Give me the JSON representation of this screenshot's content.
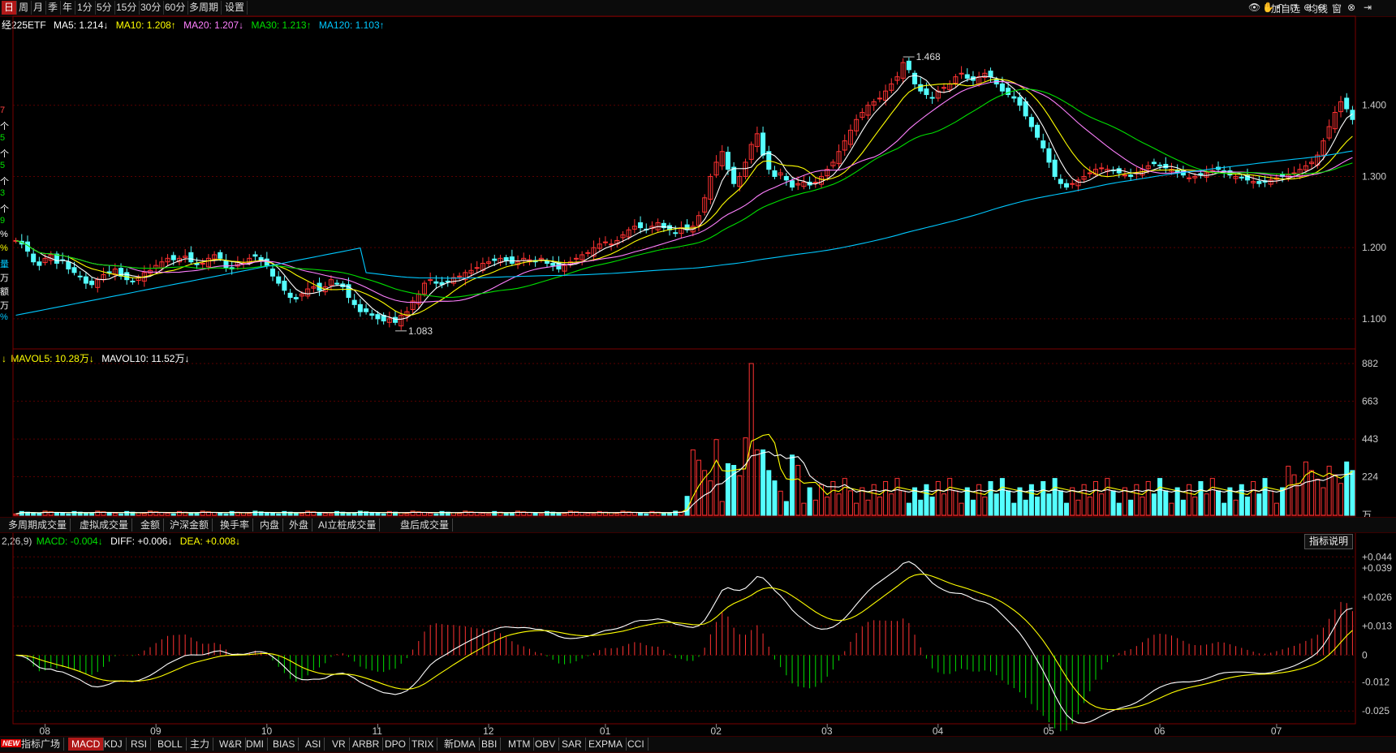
{
  "toolbar": {
    "periods": [
      "日",
      "周",
      "月",
      "季",
      "年",
      "1分",
      "5分",
      "15分",
      "30分",
      "60分",
      "多周期",
      "设置"
    ],
    "active_period": "日",
    "right_labels": [
      "加自选",
      "均线",
      "窗"
    ]
  },
  "price_info": {
    "title": "经225ETF",
    "ma5": "MA5: 1.214↓",
    "ma10": "MA10: 1.208↑",
    "ma20": "MA20: 1.207↓",
    "ma30": "MA30: 1.213↑",
    "ma120": "MA120: 1.103↑"
  },
  "volume_info": {
    "prefix": "↓",
    "mavol5": "MAVOL5: 10.28万↓",
    "mavol10": "MAVOL10: 11.52万↓"
  },
  "macd_info": {
    "params": "2,26,9)",
    "macd": "MACD: -0.004↓",
    "diff": "DIFF: +0.006↓",
    "dea": "DEA: +0.008↓"
  },
  "volume_tabs": [
    "多周期成交量",
    "虚拟成交量",
    "金额",
    "沪深金额",
    "换手率",
    "内盘",
    "外盘",
    "AI立桩成交量",
    "盘后成交量"
  ],
  "indicator_tabs": [
    "指标广场",
    "MACD",
    "KDJ",
    "RSI",
    "BOLL",
    "主力",
    "W&R",
    "DMI",
    "BIAS",
    "ASI",
    "VR",
    "ARBR",
    "DPO",
    "TRIX",
    "新DMA",
    "BBI",
    "MTM",
    "OBV",
    "SAR",
    "EXPMA",
    "CCI"
  ],
  "active_indicator": "MACD",
  "new_badge": "NEW",
  "explain_button": "指标说明",
  "left_strip": [
    "7",
    "个",
    "5",
    "个",
    "5",
    "个",
    "3",
    "个",
    "9",
    "%",
    "%",
    "量",
    "万",
    "额",
    "万",
    "%"
  ],
  "colors": {
    "up": "#ff3232",
    "down": "#54ffff",
    "ma5": "#ffffff",
    "ma10": "#ffff00",
    "ma20": "#ff80ff",
    "ma30": "#00e000",
    "ma120": "#00c8ff",
    "grid": "#5a0000"
  },
  "chart_data": [
    {
      "type": "candlestick",
      "x_months": [
        "08",
        "09",
        "10",
        "11",
        "12",
        "01",
        "02",
        "03",
        "04",
        "05",
        "06",
        "07"
      ],
      "y_ticks": [
        1.1,
        1.2,
        1.3,
        1.4
      ],
      "ylim": [
        1.06,
        1.5
      ],
      "annotations": [
        {
          "label": "1.468",
          "value": 1.468,
          "note": "high"
        },
        {
          "label": "1.083",
          "value": 1.083,
          "note": "low"
        }
      ],
      "close": [
        1.21,
        1.205,
        1.195,
        1.18,
        1.175,
        1.185,
        1.19,
        1.178,
        1.182,
        1.17,
        1.165,
        1.16,
        1.15,
        1.148,
        1.155,
        1.162,
        1.165,
        1.17,
        1.16,
        1.155,
        1.152,
        1.158,
        1.165,
        1.168,
        1.175,
        1.18,
        1.185,
        1.183,
        1.185,
        1.188,
        1.18,
        1.176,
        1.178,
        1.185,
        1.19,
        1.185,
        1.172,
        1.17,
        1.18,
        1.178,
        1.185,
        1.188,
        1.182,
        1.175,
        1.16,
        1.15,
        1.14,
        1.13,
        1.128,
        1.135,
        1.142,
        1.145,
        1.14,
        1.145,
        1.155,
        1.15,
        1.145,
        1.13,
        1.12,
        1.11,
        1.11,
        1.105,
        1.1,
        1.097,
        1.1,
        1.095,
        1.105,
        1.11,
        1.125,
        1.135,
        1.15,
        1.155,
        1.15,
        1.148,
        1.152,
        1.158,
        1.16,
        1.165,
        1.168,
        1.172,
        1.178,
        1.18,
        1.182,
        1.185,
        1.182,
        1.178,
        1.18,
        1.185,
        1.183,
        1.18,
        1.185,
        1.178,
        1.175,
        1.17,
        1.175,
        1.18,
        1.185,
        1.19,
        1.193,
        1.2,
        1.205,
        1.208,
        1.205,
        1.21,
        1.218,
        1.225,
        1.23,
        1.228,
        1.225,
        1.23,
        1.235,
        1.228,
        1.225,
        1.22,
        1.228,
        1.225,
        1.23,
        1.245,
        1.27,
        1.3,
        1.32,
        1.335,
        1.31,
        1.29,
        1.3,
        1.32,
        1.345,
        1.36,
        1.33,
        1.31,
        1.3,
        1.305,
        1.295,
        1.285,
        1.29,
        1.292,
        1.288,
        1.292,
        1.3,
        1.31,
        1.32,
        1.335,
        1.35,
        1.365,
        1.38,
        1.39,
        1.4,
        1.405,
        1.41,
        1.42,
        1.43,
        1.44,
        1.46,
        1.45,
        1.43,
        1.42,
        1.415,
        1.41,
        1.42,
        1.425,
        1.43,
        1.44,
        1.445,
        1.438,
        1.435,
        1.44,
        1.445,
        1.44,
        1.43,
        1.42,
        1.415,
        1.41,
        1.4,
        1.385,
        1.37,
        1.355,
        1.34,
        1.32,
        1.3,
        1.29,
        1.285,
        1.29,
        1.295,
        1.3,
        1.305,
        1.31,
        1.312,
        1.31,
        1.308,
        1.305,
        1.302,
        1.3,
        1.305,
        1.31,
        1.315,
        1.318,
        1.315,
        1.312,
        1.31,
        1.305,
        1.302,
        1.298,
        1.3,
        1.302,
        1.305,
        1.308,
        1.31,
        1.306,
        1.302,
        1.3,
        1.298,
        1.295,
        1.293,
        1.29,
        1.292,
        1.295,
        1.298,
        1.3,
        1.302,
        1.305,
        1.31,
        1.315,
        1.32,
        1.33,
        1.35,
        1.37,
        1.39,
        1.405,
        1.395,
        1.38
      ],
      "series": [
        {
          "name": "MA5"
        },
        {
          "name": "MA10"
        },
        {
          "name": "MA20"
        },
        {
          "name": "MA30"
        },
        {
          "name": "MA120"
        }
      ]
    },
    {
      "type": "bar",
      "y_ticks": [
        224,
        443,
        663,
        882
      ],
      "ylim": [
        0,
        882
      ],
      "unit": "万",
      "peak": 882
    },
    {
      "type": "bar",
      "y_ticks": [
        0.044,
        0.039,
        0.026,
        0.013,
        0,
        -0.012,
        -0.025
      ],
      "y_tick_labels": [
        "+0.044",
        "+0.039",
        "+0.026",
        "+0.013",
        "0",
        "-0.012",
        "-0.025"
      ],
      "ylim": [
        -0.03,
        0.047
      ],
      "series": [
        {
          "name": "DIFF"
        },
        {
          "name": "DEA"
        },
        {
          "name": "MACD"
        }
      ]
    }
  ]
}
